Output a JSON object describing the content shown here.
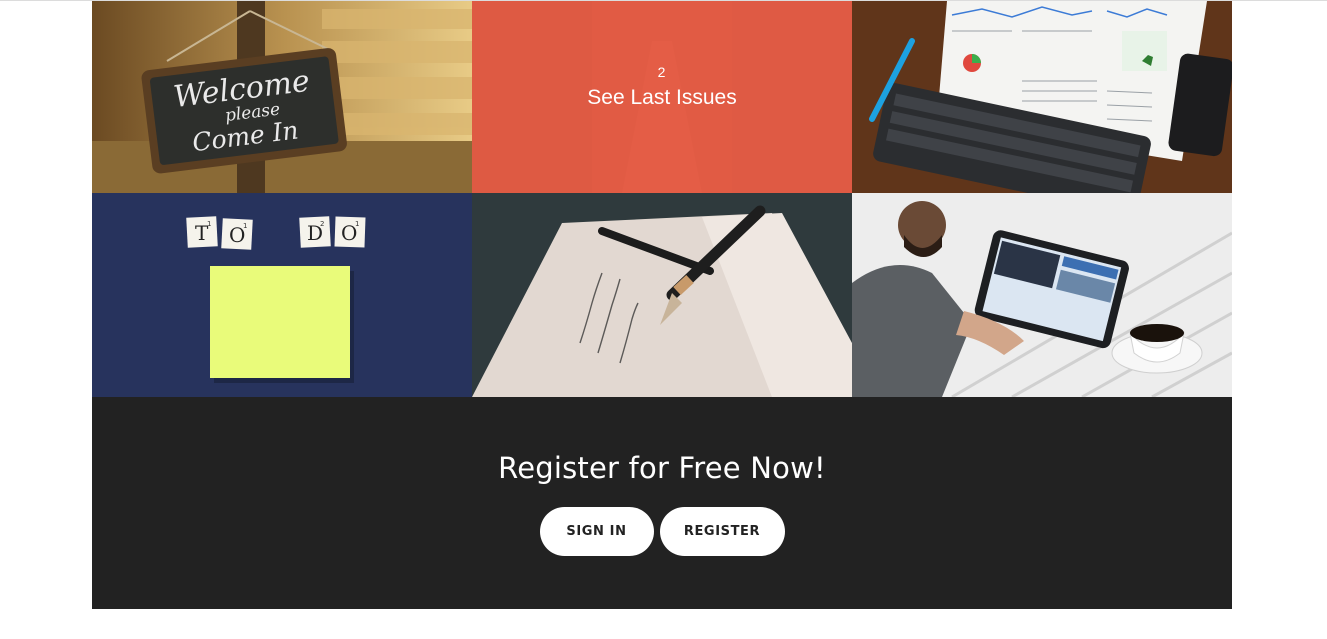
{
  "gallery": {
    "tiles": [
      {
        "name": "welcome-sign",
        "chalk_line1": "Welcome",
        "chalk_line2": "please",
        "chalk_line3": "Come In"
      },
      {
        "name": "last-issues",
        "number": "2",
        "label": "See Last Issues"
      },
      {
        "name": "analytics-desk"
      },
      {
        "name": "todo-board",
        "letters": [
          "T",
          "O",
          "D",
          "O"
        ],
        "subscripts": [
          "1",
          "1",
          "2",
          "1"
        ]
      },
      {
        "name": "pen-notebook"
      },
      {
        "name": "tablet-coffee"
      }
    ]
  },
  "register": {
    "heading": "Register for Free Now!",
    "signin_label": "SIGN IN",
    "register_label": "REGISTER"
  },
  "colors": {
    "accent": "#e95e46",
    "dark_band": "#222222",
    "button_bg": "#ffffff"
  }
}
